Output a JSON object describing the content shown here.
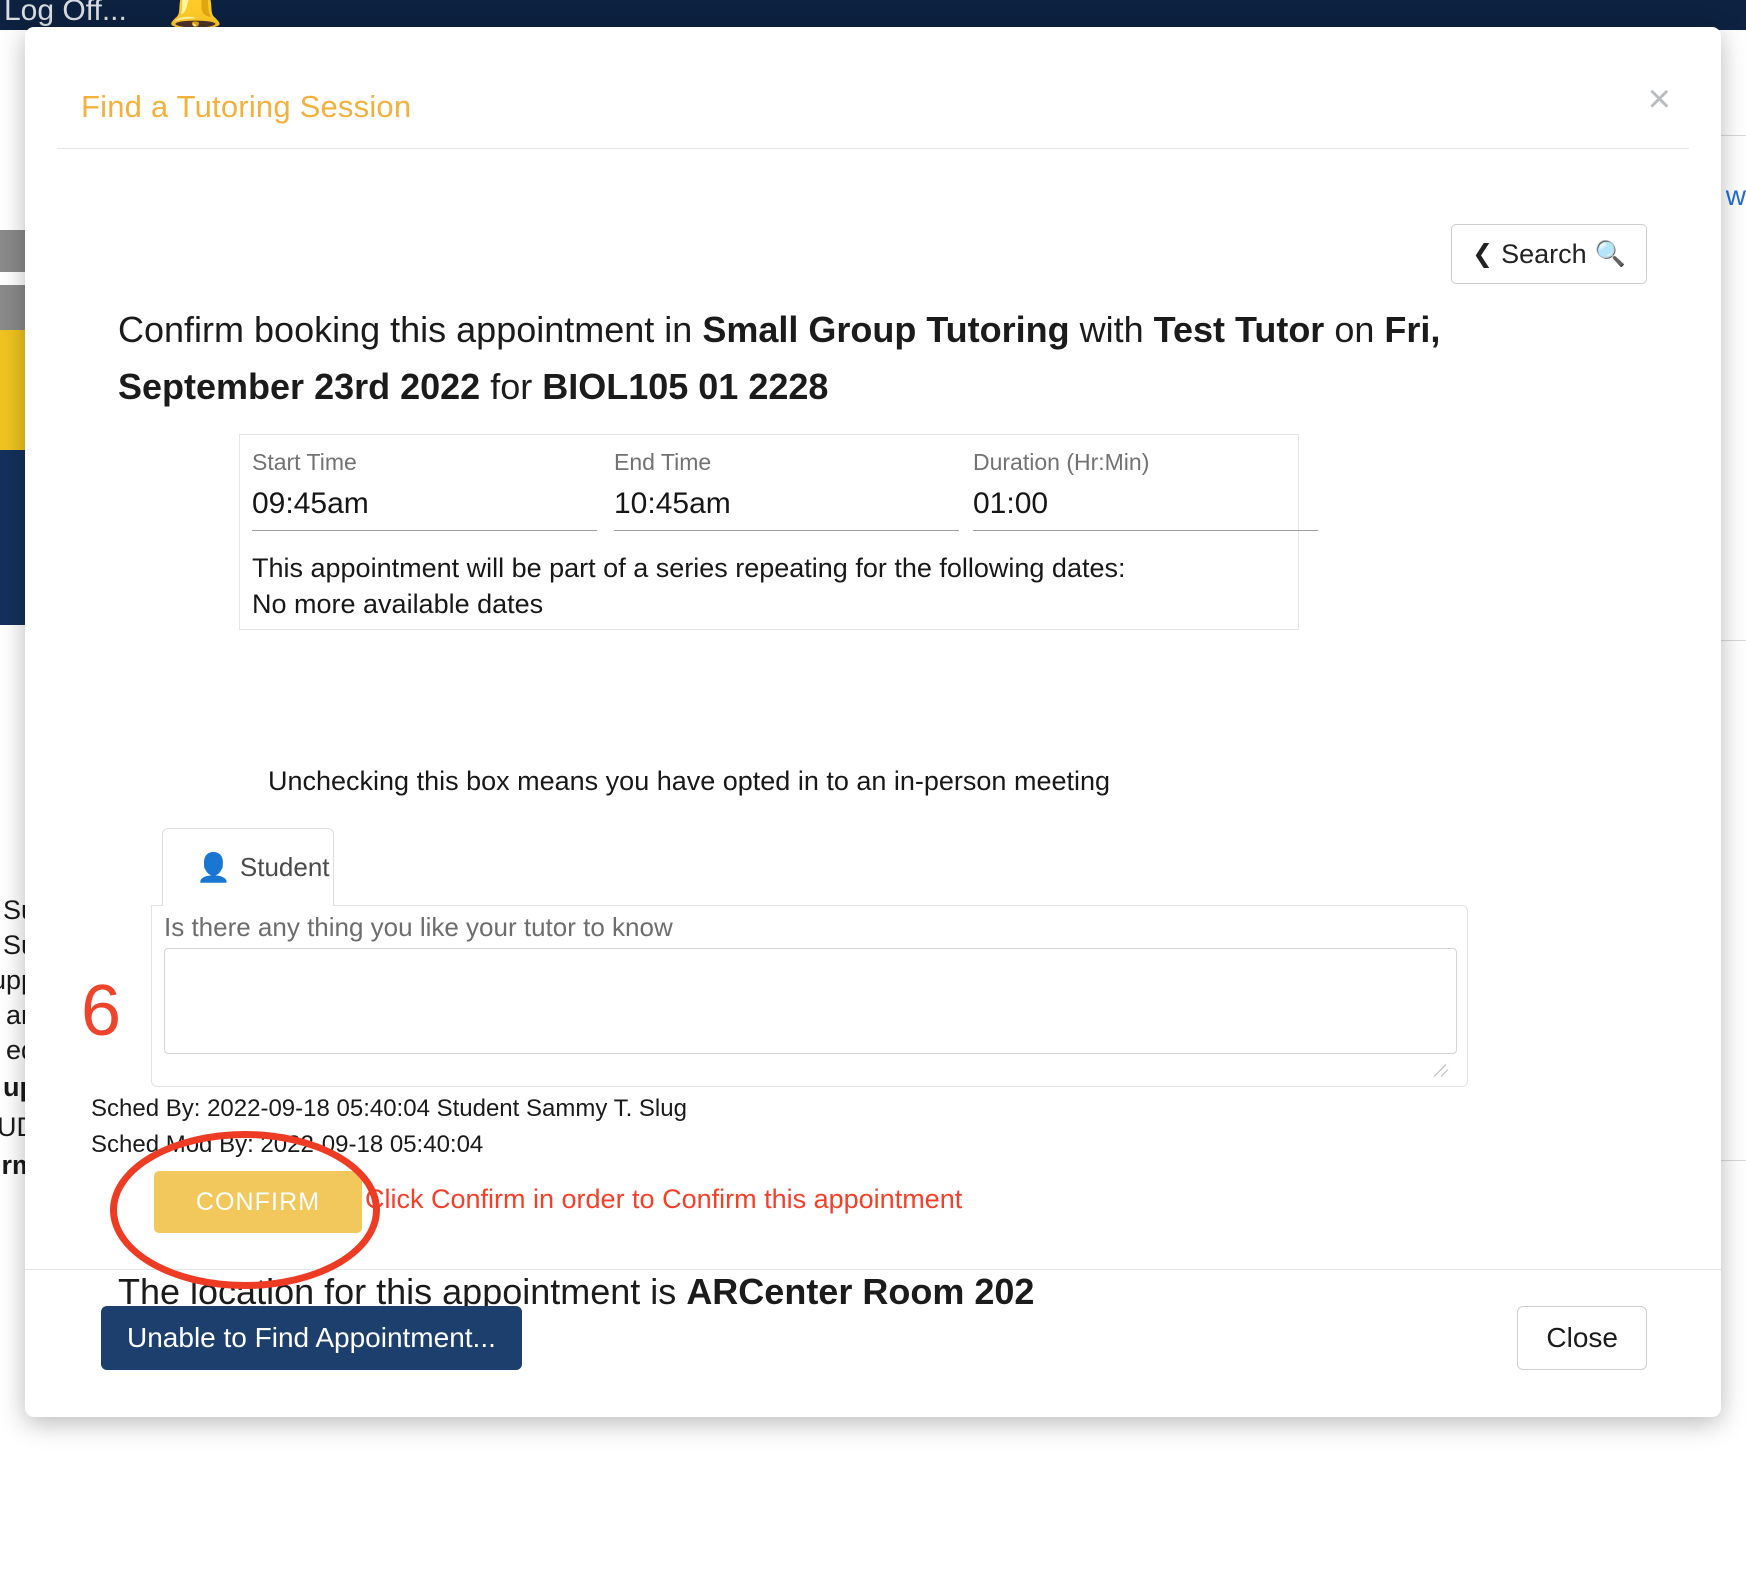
{
  "background": {
    "log_off": "Log Off...",
    "bell_icon": "bell-icon",
    "right_link_fragment": "w",
    "left_fragments": [
      "Su",
      "Su",
      "upp",
      "an",
      "ed",
      "up",
      "UD",
      "rm"
    ]
  },
  "modal": {
    "title": "Find a Tutoring Session",
    "close_label": "×",
    "search_button": {
      "label": "Search",
      "chevron": "‹",
      "magnifier": "⌕"
    },
    "confirm_heading": {
      "part1": "Confirm booking this appointment in ",
      "bold1": "Small Group Tutoring",
      "part2": " with ",
      "bold2": "Test Tutor",
      "part3": " on ",
      "bold3": "Fri, September 23rd 2022",
      "part4": " for ",
      "bold4": "BIOL105 01 2228"
    },
    "time_fields": [
      {
        "label": "Start Time",
        "value": "09:45am"
      },
      {
        "label": "End Time",
        "value": "10:45am"
      },
      {
        "label": "Duration (Hr:Min)",
        "value": "01:00"
      }
    ],
    "series": {
      "line1": "This appointment will be part of a series repeating for the following dates:",
      "line2": "No more available dates"
    },
    "uncheck_note": "Unchecking this box means you have opted in to an in-person meeting",
    "tab": {
      "icon": "person-icon",
      "label": "Student"
    },
    "textarea": {
      "label": "Is there any thing you like your tutor to know",
      "value": "",
      "placeholder": ""
    },
    "sched_by": "Sched By: 2022-09-18 05:40:04 Student Sammy T. Slug",
    "sched_mod_by": "Sched Mod By: 2022-09-18 05:40:04",
    "confirm_button": "CONFIRM",
    "confirm_hint": "Click Confirm in order to Confirm this appointment",
    "location": {
      "prefix": "The location for this appointment is ",
      "bold": "ARCenter Room 202"
    },
    "footer": {
      "unable_label": "Unable to Find Appointment...",
      "close_label": "Close"
    }
  },
  "annotation": {
    "step_number": "6"
  },
  "colors": {
    "accent_yellow": "#f2b13c",
    "confirm_yellow": "#f2c75c",
    "annotation_red": "#ee3b24",
    "hint_red": "#f4402a",
    "navy": "#1c3f6e",
    "topbar": "#0d2240"
  }
}
